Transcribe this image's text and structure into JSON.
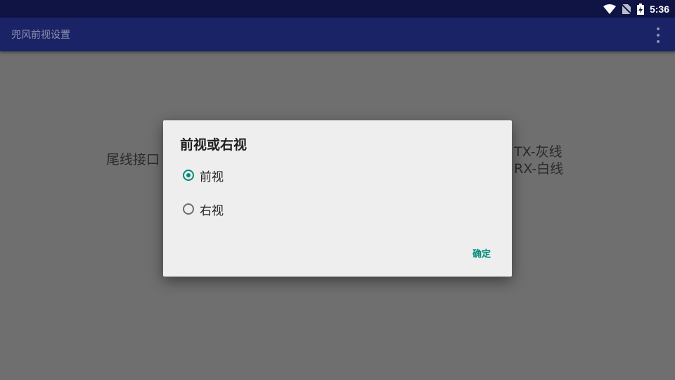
{
  "status_bar": {
    "time": "5:36",
    "icons": [
      "wifi-icon",
      "no-sim-icon",
      "battery-charging-icon"
    ]
  },
  "app_bar": {
    "title": "兜风前视设置",
    "overflow_icon": "more-vert-icon"
  },
  "background": {
    "left_text": "尾线接口",
    "right_line1": "TX-灰线",
    "right_line2": "RX-白线"
  },
  "dialog": {
    "title": "前视或右视",
    "options": [
      {
        "label": "前视",
        "selected": true
      },
      {
        "label": "右视",
        "selected": false
      }
    ],
    "confirm_label": "确定",
    "accent_color": "#00897b"
  }
}
